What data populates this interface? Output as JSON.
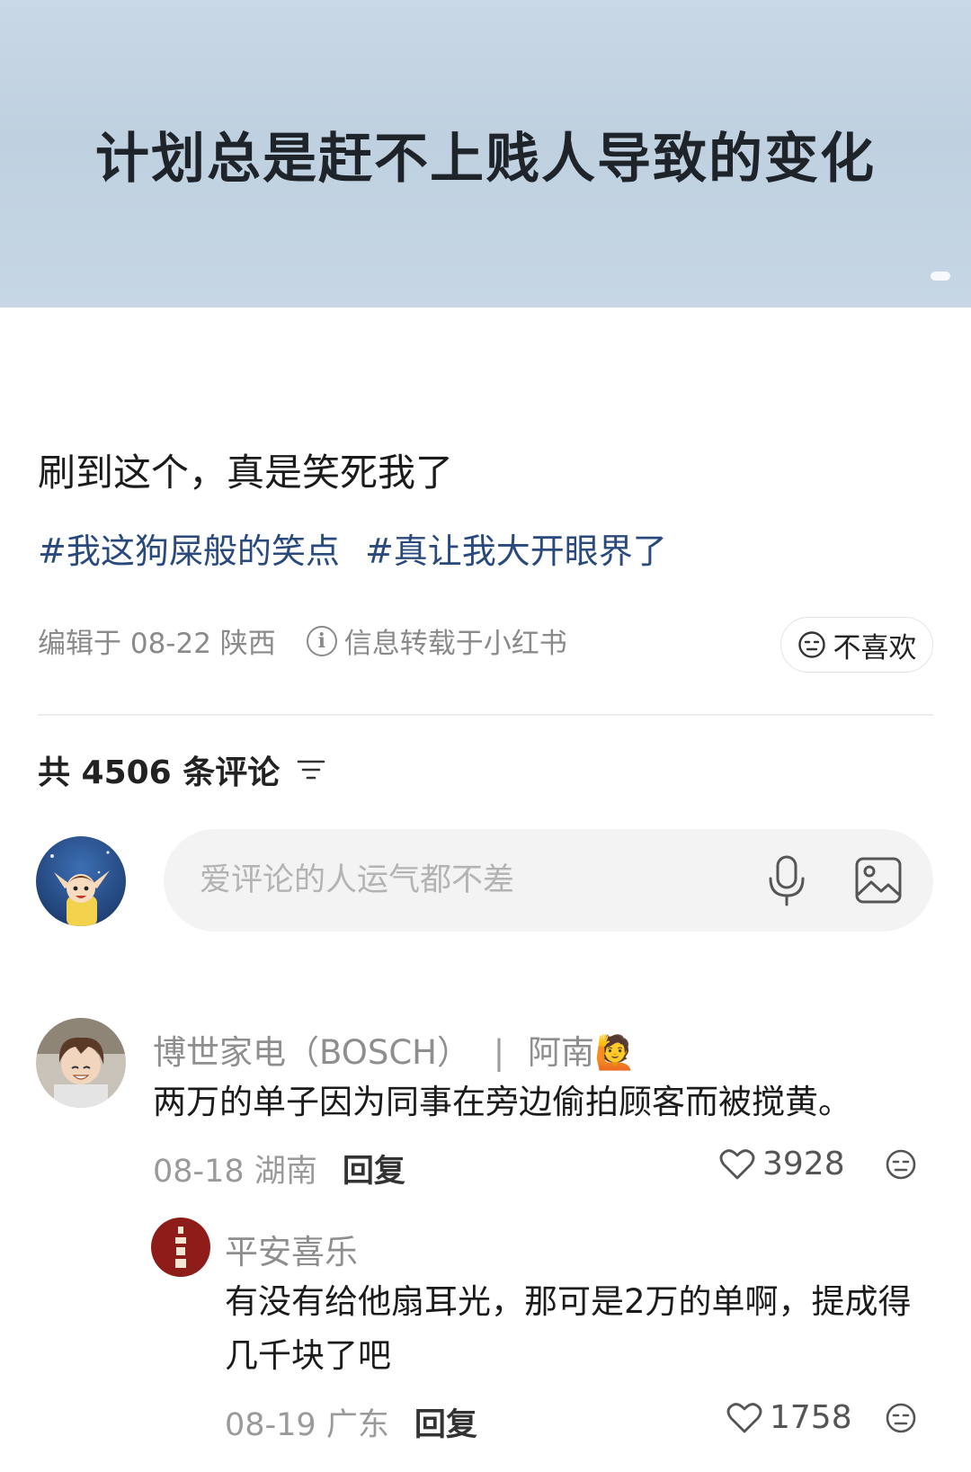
{
  "hero": {
    "caption": "计划总是赶不上贱人导致的变化"
  },
  "post": {
    "text": "刷到这个，真是笑死我了",
    "tags": [
      "#我这狗屎般的笑点",
      "#真让我大开眼界了"
    ],
    "edited": "编辑于 08-22 陕西",
    "source": "信息转载于小红书",
    "dislike_label": "不喜欢"
  },
  "comments_header": {
    "count_label": "共 4506 条评论"
  },
  "composer": {
    "placeholder": "爱评论的人运气都不差"
  },
  "comments": [
    {
      "name": "博世家电（BOSCH）",
      "suffix": "阿南🙋",
      "text": "两万的单子因为同事在旁边偷拍顾客而被搅黄。",
      "date_loc": "08-18 湖南",
      "reply_label": "回复",
      "likes": "3928",
      "replies": [
        {
          "name": "平安喜乐",
          "text": "有没有给他扇耳光，那可是2万的单啊，提成得几千块了吧",
          "date_loc": "08-19 广东",
          "reply_label": "回复",
          "likes": "1758"
        }
      ]
    }
  ],
  "colors": {
    "tag": "#2a4a7d",
    "muted": "#8e8e8e",
    "input_bg": "#f3f3f3"
  }
}
